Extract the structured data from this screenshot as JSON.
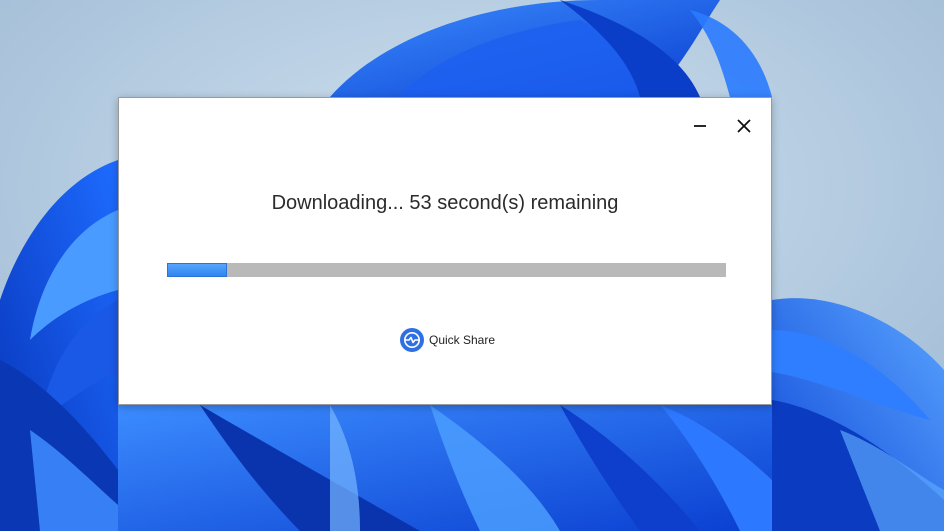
{
  "dialog": {
    "status_text": "Downloading... 53 second(s) remaining",
    "progress": 0.108,
    "brand_label": "Quick Share",
    "minimize_icon": "minimize-icon",
    "close_icon": "close-icon",
    "brand_icon": "quick-share-icon"
  },
  "colors": {
    "accent": "#2e82f0",
    "track": "#b9b9b9",
    "wallpaper": "#a9c4dc"
  }
}
